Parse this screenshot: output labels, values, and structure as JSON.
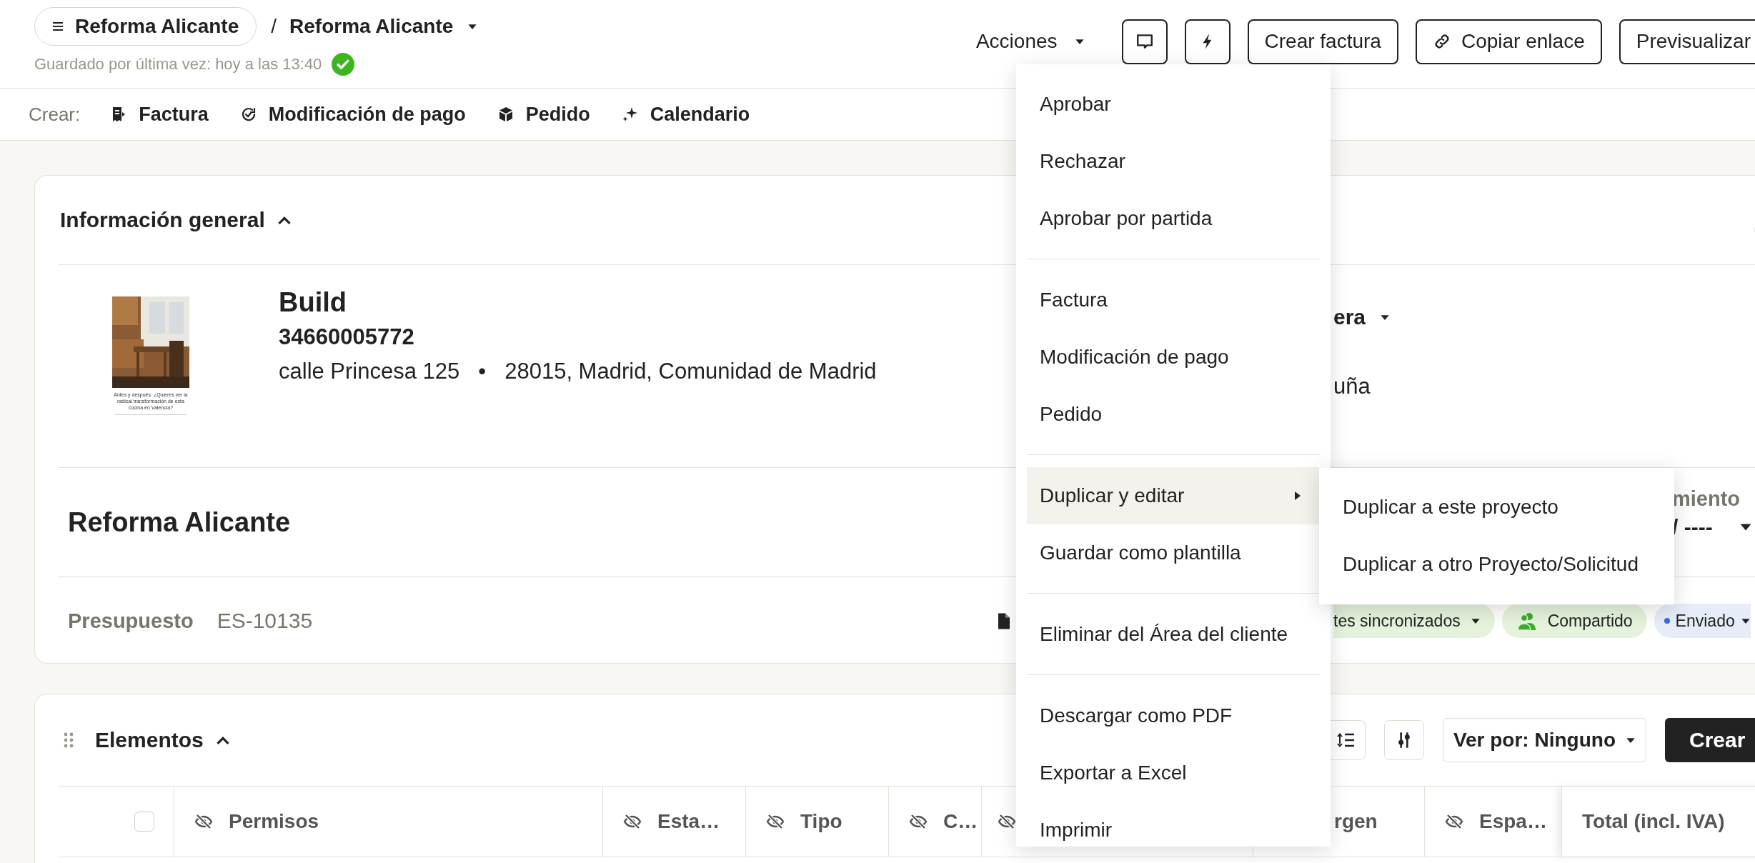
{
  "breadcrumb": {
    "project": "Reforma Alicante",
    "separator": "/",
    "document": "Reforma Alicante"
  },
  "saved_status": {
    "text": "Guardado por última vez: hoy a las 13:40",
    "saved": true
  },
  "header_actions": {
    "actions_label": "Acciones",
    "buttons": [
      {
        "kind": "comment"
      },
      {
        "kind": "bolt"
      },
      {
        "kind": "text",
        "label": "Crear factura"
      },
      {
        "kind": "link",
        "label": "Copiar enlace"
      },
      {
        "kind": "text",
        "label": "Previsualizar"
      }
    ]
  },
  "create_bar": {
    "label": "Crear:",
    "items": [
      {
        "kind": "invoice",
        "label": "Factura"
      },
      {
        "kind": "payment",
        "label": "Modificación de pago"
      },
      {
        "kind": "order",
        "label": "Pedido"
      },
      {
        "kind": "calendar",
        "label": "Calendario"
      }
    ]
  },
  "general_info": {
    "title": "Información general",
    "expanded": true,
    "thumbnail": {
      "kind": "picture",
      "caption": "Antes y después: ¿Quieres ver la radical transformación de esta cocina en Valencia?"
    },
    "client": {
      "name": "Build",
      "phone": "34660005772",
      "address": "calle Princesa 125",
      "bullet": "•",
      "city": "28015, Madrid, Comunidad de Madrid"
    },
    "field_1": "era",
    "field_2": "uña",
    "project_name": "Reforma Alicante",
    "field_3_label": "miento",
    "field_3_value": "/ ----",
    "document_type": "Presupuesto",
    "document_number": "ES-10135",
    "chips": [
      {
        "kind": "sync",
        "label": "tes sincronizados",
        "color": "#e5f3dc"
      },
      {
        "kind": "shared",
        "label": "Compartido",
        "color": "#e5f3dc"
      },
      {
        "kind": "status",
        "label": "Enviado",
        "color": "#e6edf8"
      }
    ]
  },
  "elements": {
    "title": "Elementos",
    "expanded": true,
    "view_by": "Ver por: Ninguno",
    "create_button": "Crear",
    "select_all_checked": false,
    "columns": [
      {
        "label": "Permisos",
        "hidden": true
      },
      {
        "label": "Esta…",
        "hidden": true
      },
      {
        "label": "Tipo",
        "hidden": true
      },
      {
        "label": "C…",
        "hidden": true
      },
      {
        "hidden": true
      },
      {
        "label": "rgen",
        "hidden": false
      },
      {
        "label": "Espa…",
        "hidden": true
      },
      {
        "label": "Total (incl. IVA)",
        "hidden": false
      }
    ]
  },
  "actions_menu": {
    "groups": [
      [
        {
          "label": "Aprobar",
          "selected": false
        },
        {
          "label": "Rechazar",
          "selected": false
        },
        {
          "label": "Aprobar por partida",
          "selected": false
        }
      ],
      [
        {
          "label": "Factura",
          "selected": false
        },
        {
          "label": "Modificación de pago",
          "selected": false
        },
        {
          "label": "Pedido",
          "selected": false
        }
      ],
      [
        {
          "label": "Duplicar y editar",
          "selected": true,
          "submenu": true
        },
        {
          "label": "Guardar como plantilla",
          "selected": false
        }
      ],
      [
        {
          "label": "Eliminar del Área del cliente",
          "selected": false
        }
      ],
      [
        {
          "label": "Descargar como PDF",
          "selected": false
        },
        {
          "label": "Exportar a Excel",
          "selected": false
        },
        {
          "label": "Imprimir",
          "selected": false
        }
      ]
    ],
    "submenu": [
      "Duplicar a este proyecto",
      "Duplicar a otro Proyecto/Solicitud"
    ]
  }
}
